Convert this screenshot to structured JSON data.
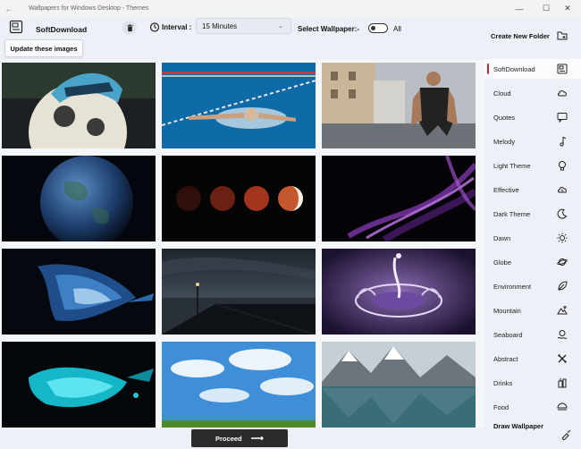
{
  "window": {
    "title": "Wallpapers for Windows Desktop - Themes",
    "back_glyph": "←",
    "minimize_glyph": "—",
    "maximize_glyph": "☐",
    "close_glyph": "✕"
  },
  "toolbar": {
    "folder_name": "SoftDownload",
    "interval_label": "Interval :",
    "interval_value": "15 Minutes",
    "select_wallpaper_label": "Select Wallpaper:-",
    "all_label": "All",
    "update_button": "Update these images",
    "create_folder": "Create New Folder"
  },
  "categories": [
    {
      "label": "SoftDownload",
      "icon": "folder-icon"
    },
    {
      "label": "Cloud",
      "icon": "cloud-icon"
    },
    {
      "label": "Quotes",
      "icon": "quote-icon"
    },
    {
      "label": "Melody",
      "icon": "music-note-icon"
    },
    {
      "label": "Light Theme",
      "icon": "lightbulb-icon"
    },
    {
      "label": "Effective",
      "icon": "effect-icon"
    },
    {
      "label": "Dark Theme",
      "icon": "moon-icon"
    },
    {
      "label": "Dawn",
      "icon": "sun-icon"
    },
    {
      "label": "Globe",
      "icon": "planet-icon"
    },
    {
      "label": "Environment",
      "icon": "leaf-icon"
    },
    {
      "label": "Mountain",
      "icon": "mountain-icon"
    },
    {
      "label": "Seaboard",
      "icon": "seaboard-icon"
    },
    {
      "label": "Abstract",
      "icon": "abstract-icon"
    },
    {
      "label": "Drinks",
      "icon": "drinks-icon"
    },
    {
      "label": "Food",
      "icon": "food-icon"
    }
  ],
  "draw_wallpaper": "Draw Wallpaper",
  "proceed_button": "Proceed",
  "proceed_arrow": "⟶",
  "thumbnails": [
    "soccer-ball-photo",
    "swimmer-photo",
    "runner-photo",
    "earth-photo",
    "lunar-phases-photo",
    "purple-smoke-photo",
    "blue-paint-splash-photo",
    "pier-photo",
    "water-splash-photo",
    "cyan-ink-photo",
    "blue-sky-photo",
    "mountain-lake-photo"
  ],
  "colors": {
    "accent": "#c0282d",
    "background": "#eef0f7",
    "proceed_bg": "#2b2b2b"
  }
}
